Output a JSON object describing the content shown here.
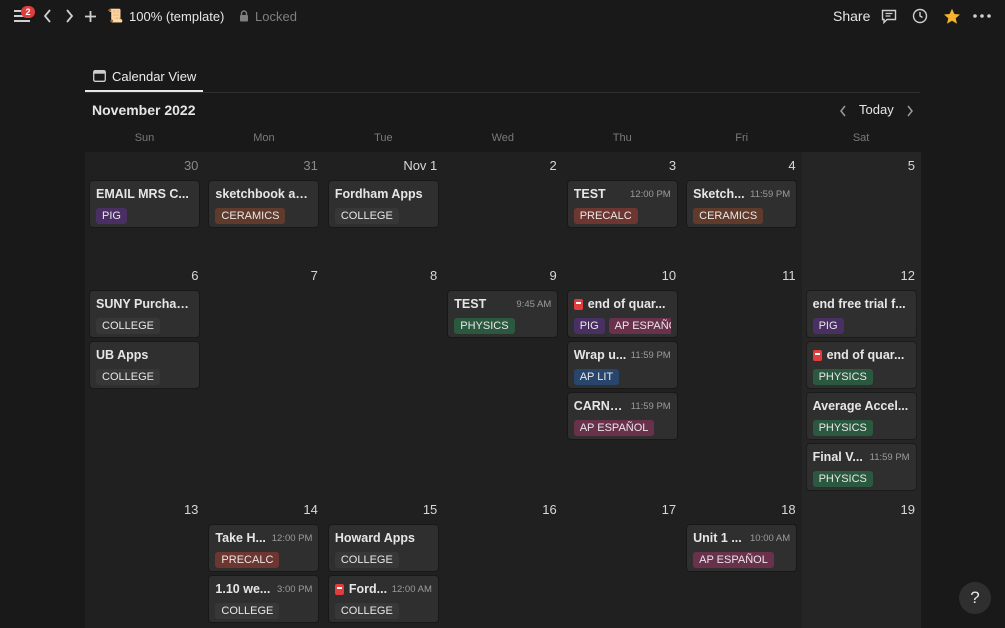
{
  "topbar": {
    "notification_count": "2",
    "page_emoji": "📜",
    "page_title": "100% (template)",
    "lock_label": "Locked",
    "share_label": "Share"
  },
  "view": {
    "tab_label": "Calendar View"
  },
  "calendar": {
    "month_label": "November 2022",
    "today_label": "Today",
    "day_headers": [
      "Sun",
      "Mon",
      "Tue",
      "Wed",
      "Thu",
      "Fri",
      "Sat"
    ],
    "weeks": [
      [
        {
          "num": "30",
          "dim": true,
          "events": [
            {
              "title": "EMAIL MRS C...",
              "time": "",
              "icon": false,
              "tags": [
                "PIG"
              ]
            }
          ]
        },
        {
          "num": "31",
          "dim": true,
          "events": [
            {
              "title": "sketchbook as...",
              "time": "",
              "icon": false,
              "tags": [
                "CERAMICS"
              ]
            }
          ]
        },
        {
          "num": "Nov 1",
          "dim": false,
          "events": [
            {
              "title": "Fordham Apps",
              "time": "",
              "icon": false,
              "tags": [
                "COLLEGE"
              ]
            }
          ]
        },
        {
          "num": "2",
          "dim": false,
          "events": []
        },
        {
          "num": "3",
          "dim": false,
          "events": [
            {
              "title": "TEST",
              "time": "12:00 PM",
              "icon": false,
              "tags": [
                "PRECALC"
              ]
            }
          ]
        },
        {
          "num": "4",
          "dim": false,
          "events": [
            {
              "title": "Sketch...",
              "time": "11:59 PM",
              "icon": false,
              "tags": [
                "CERAMICS"
              ]
            }
          ]
        },
        {
          "num": "5",
          "dim": false,
          "events": []
        }
      ],
      [
        {
          "num": "6",
          "dim": false,
          "events": [
            {
              "title": "SUNY Purchas...",
              "time": "",
              "icon": false,
              "tags": [
                "COLLEGE"
              ]
            },
            {
              "title": "UB Apps",
              "time": "",
              "icon": false,
              "tags": [
                "COLLEGE"
              ]
            }
          ]
        },
        {
          "num": "7",
          "dim": false,
          "events": []
        },
        {
          "num": "8",
          "dim": false,
          "events": []
        },
        {
          "num": "9",
          "dim": false,
          "events": [
            {
              "title": "TEST",
              "time": "9:45 AM",
              "icon": false,
              "tags": [
                "PHYSICS"
              ]
            }
          ]
        },
        {
          "num": "10",
          "dim": false,
          "events": [
            {
              "title": "end of quar...",
              "time": "",
              "icon": true,
              "tags": [
                "PIG",
                "AP ESPAÑOL"
              ]
            },
            {
              "title": "Wrap u...",
              "time": "11:59 PM",
              "icon": false,
              "tags": [
                "AP LIT"
              ]
            },
            {
              "title": "CARNE...",
              "time": "11:59 PM",
              "icon": false,
              "tags": [
                "AP ESPAÑOL"
              ]
            }
          ]
        },
        {
          "num": "11",
          "dim": false,
          "events": []
        },
        {
          "num": "12",
          "dim": false,
          "events": [
            {
              "title": "end free trial f...",
              "time": "",
              "icon": false,
              "tags": [
                "PIG"
              ]
            },
            {
              "title": "end of quar...",
              "time": "",
              "icon": true,
              "tags": [
                "PHYSICS"
              ]
            },
            {
              "title": "Average Accel...",
              "time": "",
              "icon": false,
              "tags": [
                "PHYSICS"
              ]
            },
            {
              "title": "Final V...",
              "time": "11:59 PM",
              "icon": false,
              "tags": [
                "PHYSICS"
              ]
            }
          ]
        }
      ],
      [
        {
          "num": "13",
          "dim": false,
          "events": []
        },
        {
          "num": "14",
          "dim": false,
          "events": [
            {
              "title": "Take H...",
              "time": "12:00 PM",
              "icon": false,
              "tags": [
                "PRECALC"
              ]
            },
            {
              "title": "1.10 we...",
              "time": "3:00 PM",
              "icon": false,
              "tags": [
                "COLLEGE"
              ]
            }
          ]
        },
        {
          "num": "15",
          "dim": false,
          "events": [
            {
              "title": "Howard Apps",
              "time": "",
              "icon": false,
              "tags": [
                "COLLEGE"
              ]
            },
            {
              "title": "Ford...",
              "time": "12:00 AM",
              "icon": true,
              "tags": [
                "COLLEGE"
              ]
            }
          ]
        },
        {
          "num": "16",
          "dim": false,
          "events": []
        },
        {
          "num": "17",
          "dim": false,
          "events": []
        },
        {
          "num": "18",
          "dim": false,
          "events": [
            {
              "title": "Unit 1 ...",
              "time": "10:00 AM",
              "icon": false,
              "tags": [
                "AP ESPAÑOL"
              ]
            }
          ]
        },
        {
          "num": "19",
          "dim": false,
          "events": []
        }
      ]
    ]
  },
  "tag_colors": {
    "PIG": "#492f64",
    "CERAMICS": "#603b2c",
    "COLLEGE": "#373737",
    "PRECALC": "#6e3630",
    "PHYSICS": "#2b593f",
    "AP ESPAÑOL": "#69314c",
    "AP LIT": "#28456c"
  },
  "help_label": "?"
}
